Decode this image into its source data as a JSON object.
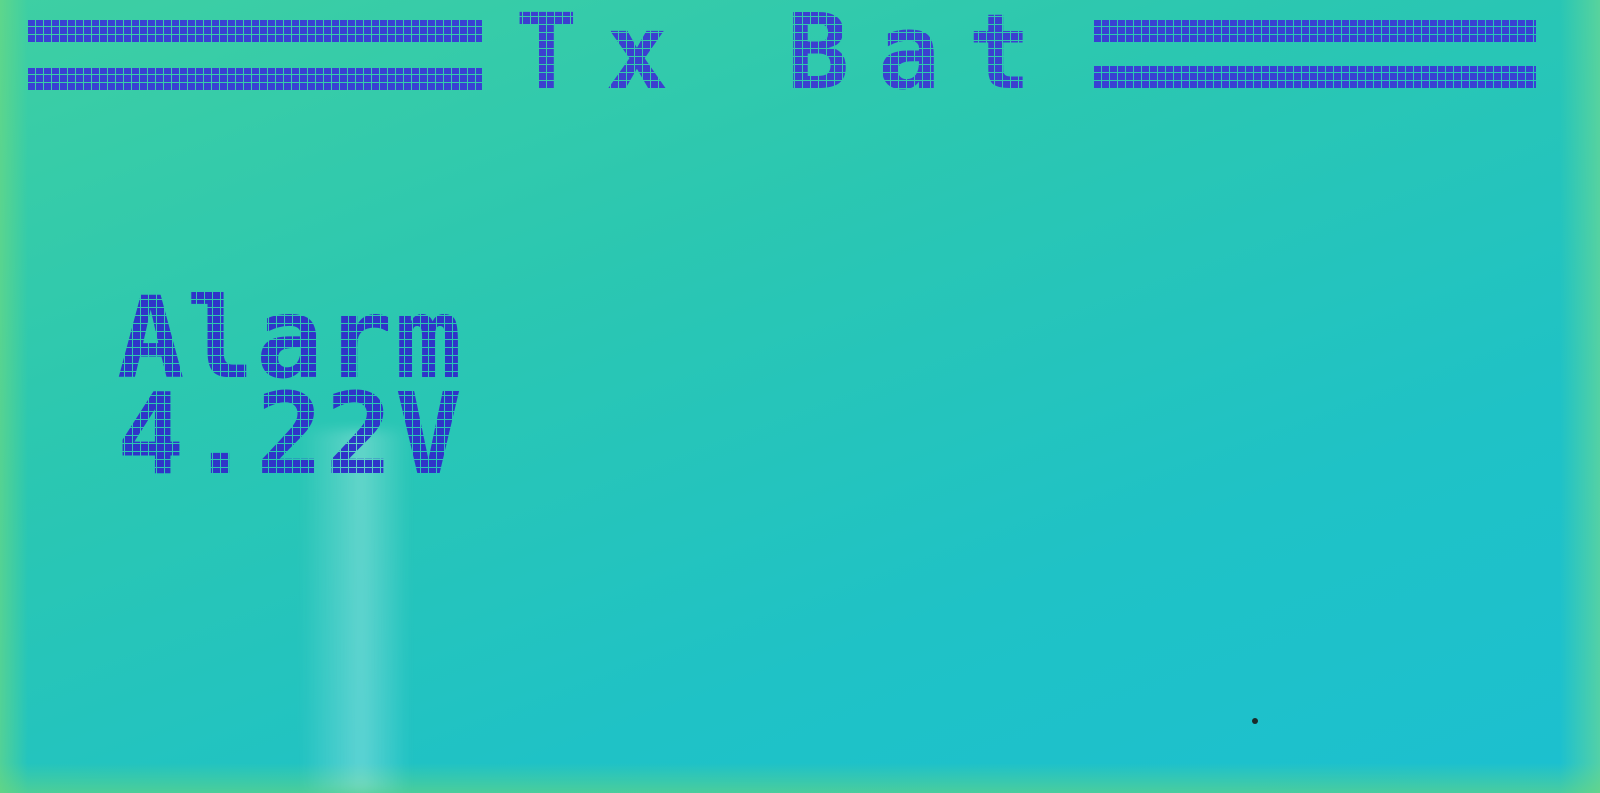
{
  "screen": {
    "title": "Tx Bat",
    "label": "Alarm",
    "value": "4.22V"
  },
  "colors": {
    "lcd_background": "#2bc7b1",
    "pixel_ink": "#3a3fd0"
  }
}
